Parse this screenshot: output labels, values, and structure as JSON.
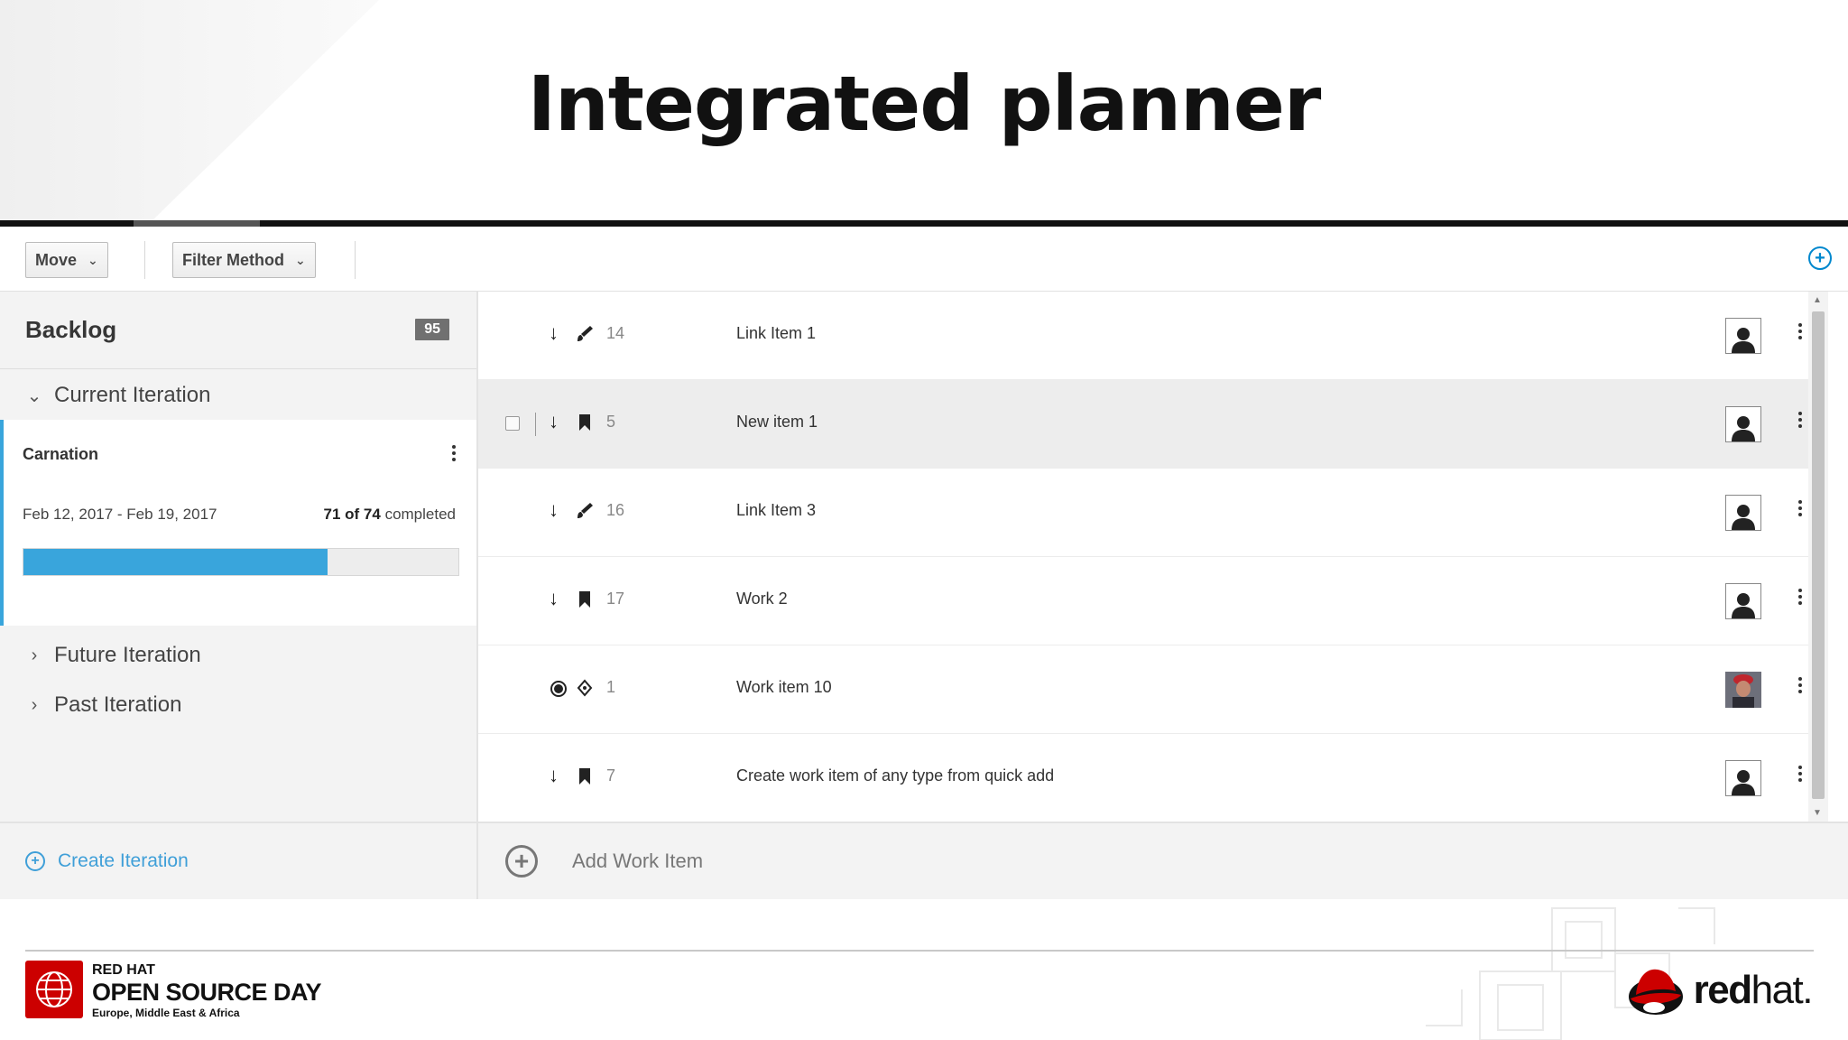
{
  "slide": {
    "title": "Integrated planner"
  },
  "toolbar": {
    "move_label": "Move",
    "filter_label": "Filter Method"
  },
  "sidebar": {
    "backlog_label": "Backlog",
    "backlog_count": "95",
    "current_iteration_label": "Current Iteration",
    "iteration": {
      "name": "Carnation",
      "dates": "Feb 12, 2017 - Feb 19, 2017",
      "completed_count": "71 of 74",
      "completed_suffix": "completed",
      "progress_fraction": 0.7
    },
    "future_iteration_label": "Future Iteration",
    "past_iteration_label": "Past Iteration",
    "create_iteration_label": "Create Iteration"
  },
  "work_items": [
    {
      "number": "14",
      "title": "Link Item 1",
      "type_icon": "paintbrush-icon",
      "lead_icon": "arrow-down-icon",
      "selected": false
    },
    {
      "number": "5",
      "title": "New item 1",
      "type_icon": "bookmark-icon",
      "lead_icon": "arrow-down-icon",
      "selected": true
    },
    {
      "number": "16",
      "title": "Link Item 3",
      "type_icon": "paintbrush-icon",
      "lead_icon": "arrow-down-icon",
      "selected": false
    },
    {
      "number": "17",
      "title": "Work 2",
      "type_icon": "bookmark-icon",
      "lead_icon": "arrow-down-icon",
      "selected": false
    },
    {
      "number": "1",
      "title": "Work item 10",
      "type_icon": "crosshair-icon",
      "lead_icon": "radio-icon",
      "selected": false
    },
    {
      "number": "7",
      "title": "Create work item of any type from quick add",
      "type_icon": "bookmark-icon",
      "lead_icon": "arrow-down-icon",
      "selected": false
    }
  ],
  "list_footer": {
    "add_work_item_label": "Add Work Item"
  },
  "branding": {
    "event_line1": "RED HAT",
    "event_line2": "OPEN SOURCE DAY",
    "event_line3": "Europe, Middle East & Africa",
    "company_bold": "red",
    "company_rest": "hat."
  },
  "colors": {
    "accent": "#39a5dc",
    "link": "#0088ce",
    "brand_red": "#cc0000"
  }
}
